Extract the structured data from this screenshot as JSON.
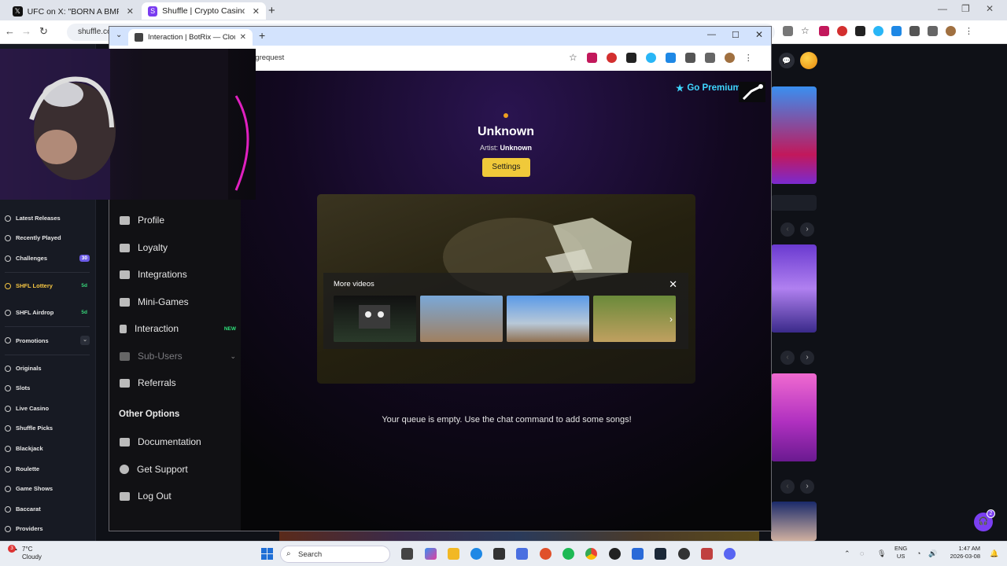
{
  "back_browser": {
    "tabs": [
      {
        "title": "UFC on X: \"BORN A BMF 🏆 @i",
        "active": false
      },
      {
        "title": "Shuffle | Crypto Casino & Bitcoi",
        "active": true
      }
    ],
    "url": "shuffle.co"
  },
  "shuffle_sidebar": {
    "items": [
      {
        "label": "Latest Releases",
        "badge": ""
      },
      {
        "label": "Recently Played",
        "badge": ""
      },
      {
        "label": "Challenges",
        "badge": "30"
      },
      {
        "label": "SHFL Lottery",
        "badge": "5d"
      },
      {
        "label": "SHFL Airdrop",
        "badge": "5d"
      },
      {
        "label": "Promotions",
        "badge": ""
      },
      {
        "label": "Originals",
        "badge": ""
      },
      {
        "label": "Slots",
        "badge": ""
      },
      {
        "label": "Live Casino",
        "badge": ""
      },
      {
        "label": "Shuffle Picks",
        "badge": ""
      },
      {
        "label": "Blackjack",
        "badge": ""
      },
      {
        "label": "Roulette",
        "badge": ""
      },
      {
        "label": "Game Shows",
        "badge": ""
      },
      {
        "label": "Baccarat",
        "badge": ""
      },
      {
        "label": "Providers",
        "badge": ""
      }
    ]
  },
  "front_browser": {
    "tab_title": "Interaction | BotRix — Cloud Str",
    "url": "ngrequest"
  },
  "botrix": {
    "nav": [
      {
        "label": "Profile",
        "tag": ""
      },
      {
        "label": "Loyalty",
        "tag": ""
      },
      {
        "label": "Integrations",
        "tag": ""
      },
      {
        "label": "Mini-Games",
        "tag": ""
      },
      {
        "label": "Interaction",
        "tag": "NEW"
      },
      {
        "label": "Sub-Users",
        "tag": ""
      },
      {
        "label": "Referrals",
        "tag": ""
      }
    ],
    "other_options_heading": "Other Options",
    "other_nav": [
      {
        "label": "Documentation"
      },
      {
        "label": "Get Support"
      },
      {
        "label": "Log Out"
      }
    ],
    "go_premium": "Go Premium",
    "song_title": "Unknown",
    "artist_label": "Artist:",
    "artist_value": "Unknown",
    "settings_button": "Settings",
    "more_videos_title": "More videos",
    "queue_empty_message": "Your queue is empty. Use the chat command to add some songs!"
  },
  "taskbar": {
    "temperature": "7°C",
    "weather": "Cloudy",
    "search_placeholder": "Search",
    "language_line1": "ENG",
    "language_line2": "US",
    "time": "1:47 AM",
    "date": "2026-03-08",
    "notification_count": "3",
    "support_badge": "2"
  },
  "colors": {
    "accent_yellow": "#f0c93a",
    "premium_cyan": "#3fd6ff",
    "new_green": "#2ee07a",
    "lottery_gold": "#f5c542"
  }
}
